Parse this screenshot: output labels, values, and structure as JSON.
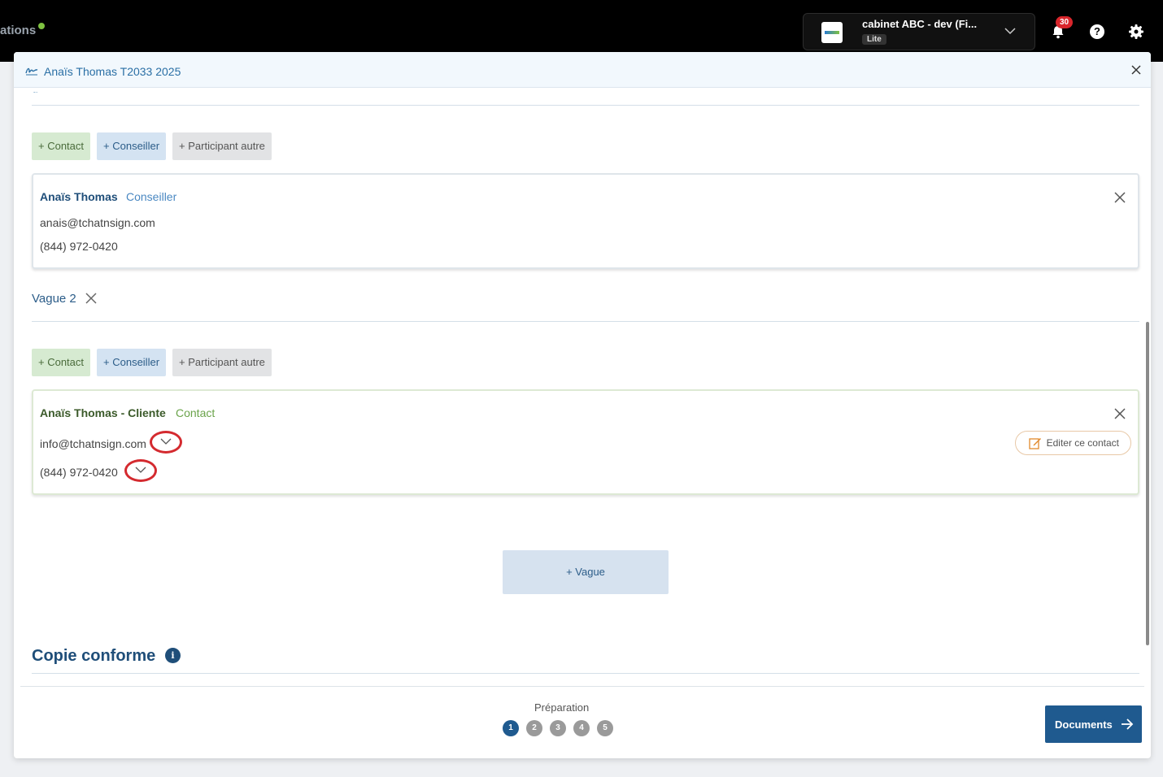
{
  "topbar": {
    "app_name": "ations",
    "org_name": "cabinet ABC - dev (Fi...",
    "org_tag": "Lite",
    "notifications_count": "30"
  },
  "modal": {
    "title": "Anaïs Thomas T2033 2025",
    "cut_text": "g"
  },
  "buttons": {
    "add_contact": "+ Contact",
    "add_advisor": "+ Conseiller",
    "add_other": "+ Participant autre"
  },
  "wave1": {
    "card": {
      "name": "Anaïs Thomas",
      "role": "Conseiller",
      "email": "anais@tchatnsign.com",
      "phone": "(844) 972-0420"
    }
  },
  "wave2": {
    "label": "Vague 2",
    "card": {
      "name": "Anaïs Thomas - Cliente",
      "role": "Contact",
      "email": "info@tchatnsign.com",
      "phone": "(844) 972-0420",
      "edit_label": "Editer ce contact"
    }
  },
  "add_wave_label": "+ Vague",
  "cc_title": "Copie conforme",
  "footer": {
    "step_label": "Préparation",
    "steps": [
      "1",
      "2",
      "3",
      "4",
      "5"
    ],
    "active_step": "1",
    "next_label": "Documents"
  },
  "colors": {
    "primary": "#1f5a8f",
    "contact_green": "#d6ead1",
    "advisor_blue": "#d4e3f2",
    "annotation_red": "#d42a2f"
  }
}
